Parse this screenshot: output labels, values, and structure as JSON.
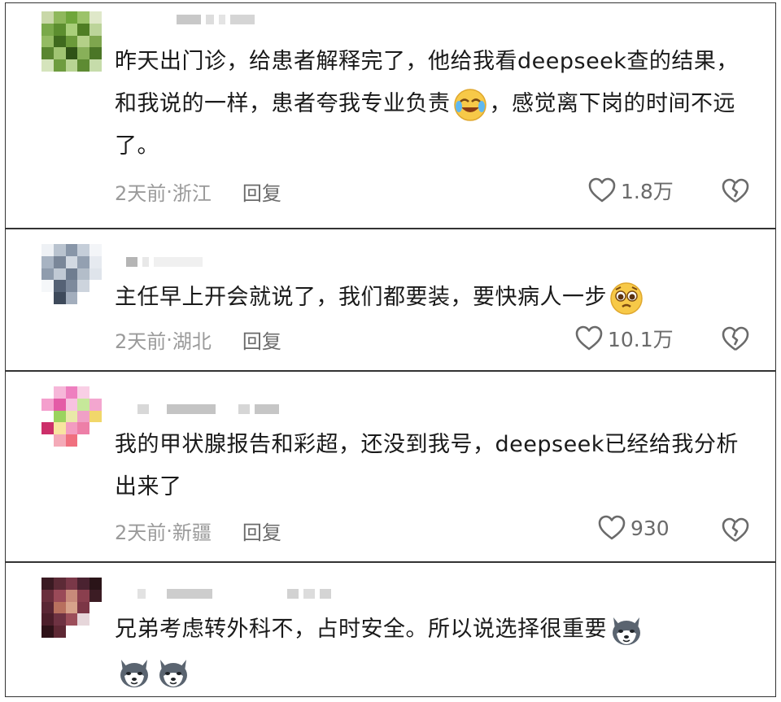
{
  "comments": [
    {
      "text": "昨天出门诊，给患者解释完了，他给我看deepseek查的结果，和我说的一样，患者夸我专业负责",
      "text_after": "，感觉离下岗的时间不远了。",
      "emoji": "crying-laughing",
      "time": "2天前",
      "location": "浙江",
      "reply_label": "回复",
      "likes": "1.8万"
    },
    {
      "text": "主任早上开会就说了，我们都要装，要快病人一步",
      "text_after": "",
      "emoji": "pleading-face",
      "time": "2天前",
      "location": "湖北",
      "reply_label": "回复",
      "likes": "10.1万"
    },
    {
      "text": "我的甲状腺报告和彩超，还没到我号，deepseek已经给我分析出来了",
      "text_after": "",
      "emoji": "",
      "time": "2天前",
      "location": "新疆",
      "reply_label": "回复",
      "likes": "930"
    },
    {
      "text": "兄弟考虑转外科不，占时安全。所以说选择很重要",
      "text_after": "",
      "emoji": "husky",
      "time": "",
      "location": "",
      "reply_label": "",
      "likes": ""
    }
  ],
  "separator": " · ",
  "colors": {
    "meta_text": "#9a9a9a",
    "icon_stroke": "#6a6a6a",
    "border": "#333333"
  },
  "icons": [
    "heart-outline-icon",
    "broken-heart-icon"
  ]
}
